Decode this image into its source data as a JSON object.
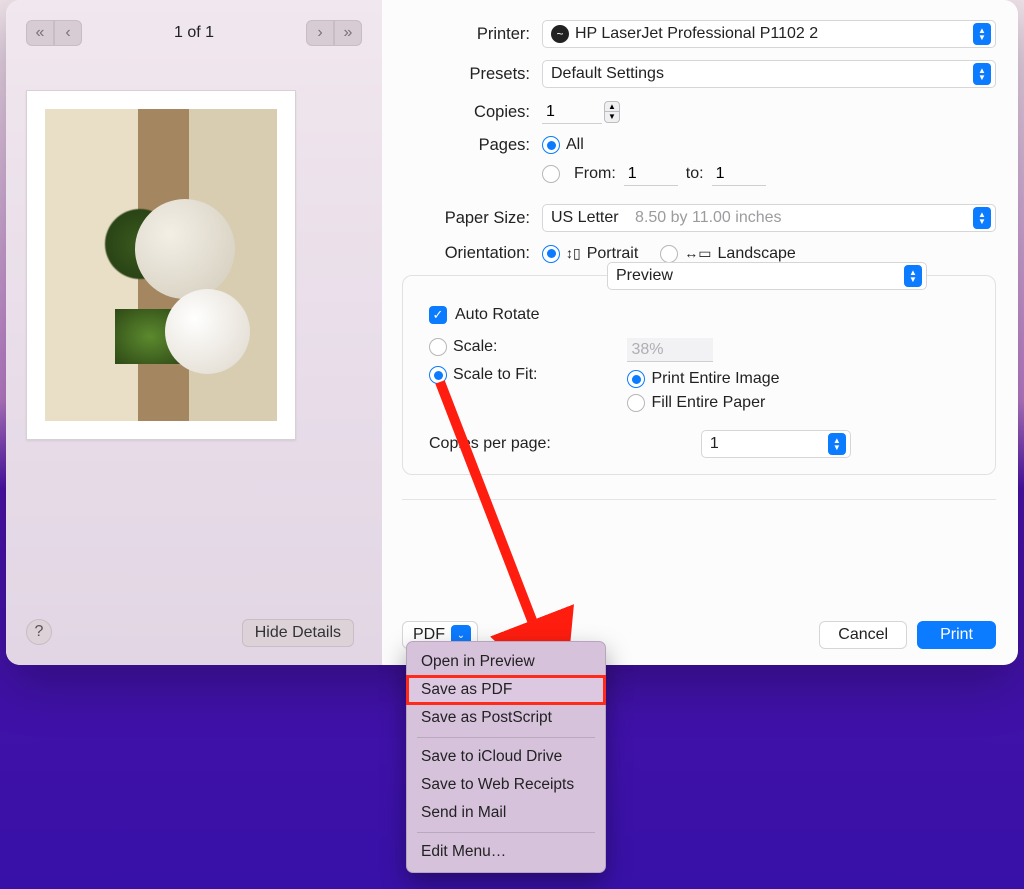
{
  "left": {
    "page_indicator": "1 of 1",
    "hide_details": "Hide Details",
    "help_glyph": "?"
  },
  "form": {
    "printer_label": "Printer:",
    "printer_value": "HP LaserJet Professional P1102 2",
    "presets_label": "Presets:",
    "presets_value": "Default Settings",
    "copies_label": "Copies:",
    "copies_value": "1",
    "pages_label": "Pages:",
    "pages_all": "All",
    "pages_from": "From:",
    "pages_from_val": "1",
    "pages_to": "to:",
    "pages_to_val": "1",
    "paper_size_label": "Paper Size:",
    "paper_size_value": "US Letter",
    "paper_size_hint": "8.50 by 11.00 inches",
    "orientation_label": "Orientation:",
    "portrait": "Portrait",
    "landscape": "Landscape"
  },
  "panel": {
    "section": "Preview",
    "auto_rotate": "Auto Rotate",
    "scale": "Scale:",
    "scale_value": "38%",
    "scale_to_fit": "Scale to Fit:",
    "print_entire": "Print Entire Image",
    "fill_paper": "Fill Entire Paper",
    "copies_per_page": "Copies per page:",
    "copies_per_page_value": "1"
  },
  "bottom": {
    "pdf": "PDF",
    "cancel": "Cancel",
    "print": "Print"
  },
  "menu": {
    "open_preview": "Open in Preview",
    "save_pdf": "Save as PDF",
    "save_ps": "Save as PostScript",
    "save_icloud": "Save to iCloud Drive",
    "save_receipts": "Save to Web Receipts",
    "send_mail": "Send in Mail",
    "edit_menu": "Edit Menu…"
  }
}
